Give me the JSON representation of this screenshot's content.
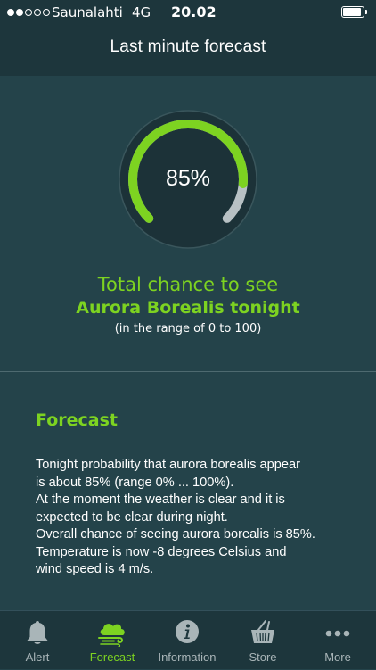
{
  "status_bar": {
    "carrier": "Saunalahti",
    "network": "4G",
    "time": "20.02",
    "signal_bars_filled": 2,
    "signal_bars_total": 5
  },
  "header": {
    "title": "Last minute forecast"
  },
  "gauge": {
    "value_label": "85%",
    "fraction": 0.85
  },
  "chance": {
    "title": "Total chance to see",
    "subject": "Aurora Borealis tonight",
    "range_note": "(in the range of 0 to 100)"
  },
  "forecast": {
    "heading": "Forecast",
    "lines": [
      "Tonight probability that aurora borealis appear",
      "is about 85% (range 0% ... 100%).",
      "At the moment the weather is clear and it is",
      "expected to be clear during night.",
      "Overall chance of seeing aurora borealis is 85%.",
      "Temperature is now -8 degrees Celsius and",
      "wind speed is 4 m/s."
    ]
  },
  "tabs": [
    {
      "label": "Alert",
      "icon": "bell-icon",
      "active": false
    },
    {
      "label": "Forecast",
      "icon": "wind-cloud-icon",
      "active": true
    },
    {
      "label": "Information",
      "icon": "info-icon",
      "active": false
    },
    {
      "label": "Store",
      "icon": "basket-icon",
      "active": false
    },
    {
      "label": "More",
      "icon": "more-dots-icon",
      "active": false
    }
  ],
  "colors": {
    "background": "#24434a",
    "bar_background": "#1d363c",
    "accent_green": "#7dd321",
    "gauge_track": "#b8c1c4",
    "tab_inactive": "#a9b5b8"
  }
}
